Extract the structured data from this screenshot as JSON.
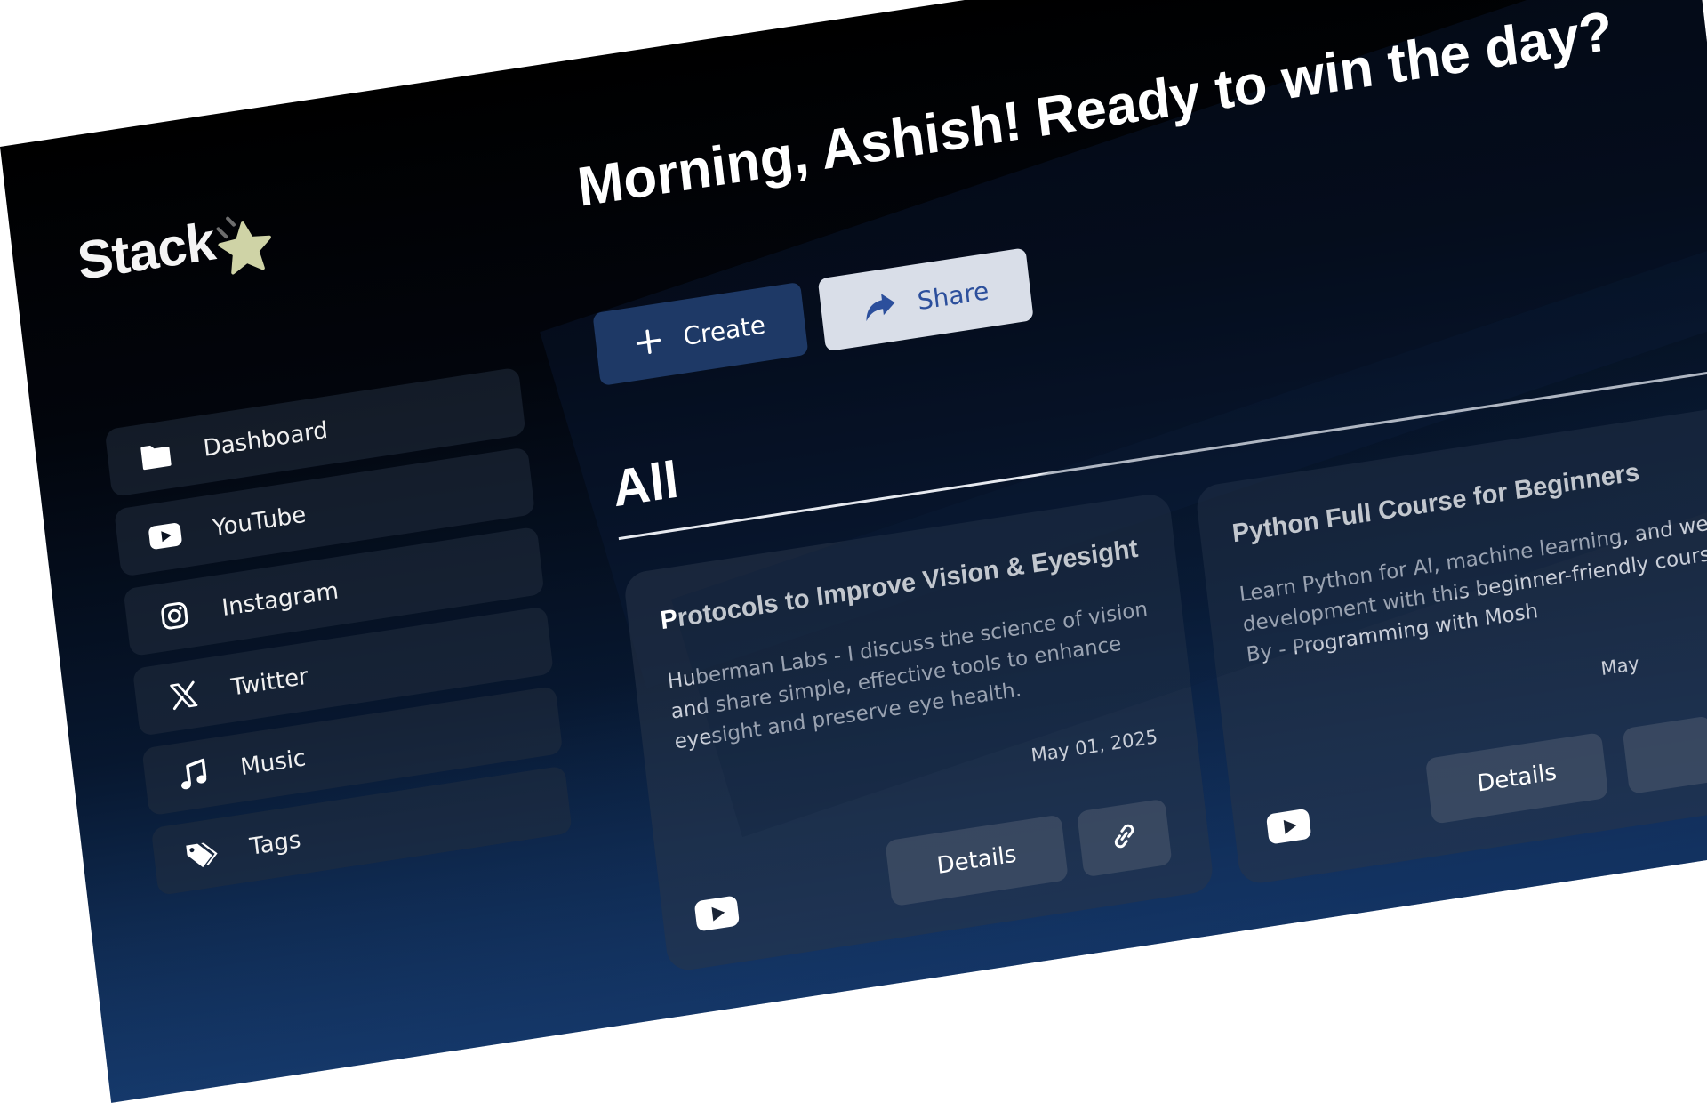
{
  "brand": {
    "name": "Stack"
  },
  "sidebar": {
    "items": [
      {
        "label": "Dashboard",
        "icon": "folder-icon"
      },
      {
        "label": "YouTube",
        "icon": "youtube-icon"
      },
      {
        "label": "Instagram",
        "icon": "instagram-icon"
      },
      {
        "label": "Twitter",
        "icon": "x-twitter-icon"
      },
      {
        "label": "Music",
        "icon": "music-note-icon"
      },
      {
        "label": "Tags",
        "icon": "tags-icon"
      }
    ]
  },
  "header": {
    "greeting": "Morning, Ashish! Ready to win the day?",
    "create_label": "Create",
    "share_label": "Share"
  },
  "section": {
    "title": "All"
  },
  "cards": [
    {
      "title": "Protocols to Improve Vision & Eyesight",
      "description": "Huberman Labs - I discuss the science of vision and share simple, effective tools to enhance eyesight and preserve eye health.",
      "date": "May 01, 2025",
      "source_icon": "youtube-icon",
      "details_label": "Details"
    },
    {
      "title": "Python Full Course for Beginners",
      "description": "Learn Python for AI, machine learning, and web development with this beginner-friendly course! By - Programming with Mosh",
      "date": "May",
      "source_icon": "youtube-icon",
      "details_label": "Details"
    }
  ],
  "colors": {
    "primary_button": "#1e3966",
    "share_button_bg": "#d9dee8",
    "share_button_text": "#2c4f9c",
    "logo_star": "#cfd3a6"
  }
}
